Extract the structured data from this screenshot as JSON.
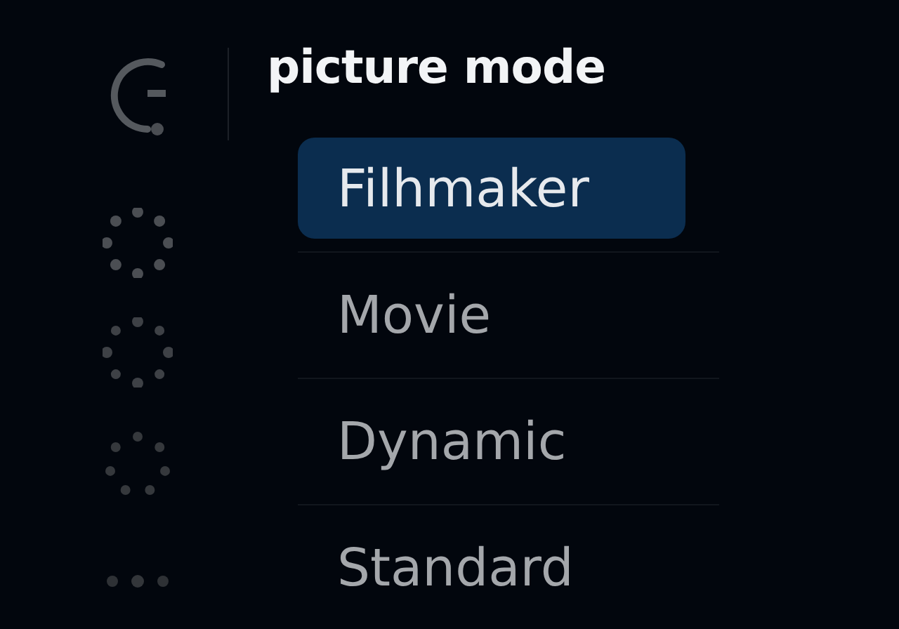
{
  "menu": {
    "title": "picture mode",
    "items": [
      {
        "label": "Filhmaker",
        "selected": true
      },
      {
        "label": "Movie",
        "selected": false
      },
      {
        "label": "Dynamic",
        "selected": false
      },
      {
        "label": "Standard",
        "selected": false
      }
    ]
  }
}
